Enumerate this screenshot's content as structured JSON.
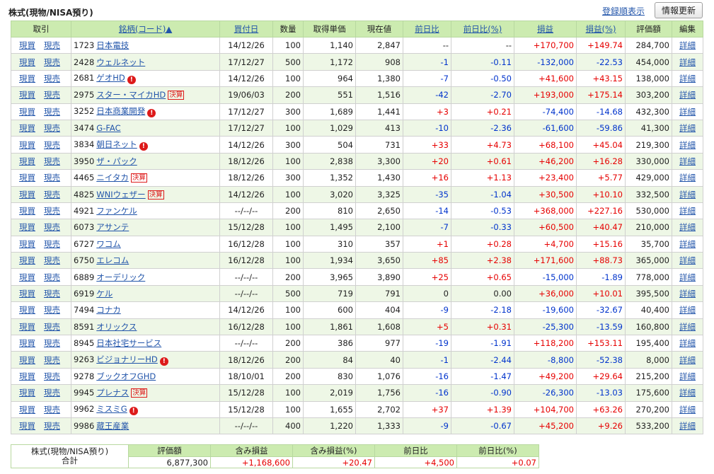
{
  "header": {
    "title": "株式(現物/NISA預り)",
    "sort_link": "登録順表示",
    "refresh_button": "情報更新"
  },
  "columns": {
    "trade": "取引",
    "name": "銘柄(コード)▲",
    "buy_date": "買付日",
    "qty": "数量",
    "cost": "取得単価",
    "price": "現在値",
    "change": "前日比",
    "change_pct": "前日比(%)",
    "pl": "損益",
    "pl_pct": "損益(%)",
    "value": "評価額",
    "edit": "編集"
  },
  "labels": {
    "buy": "現買",
    "sell": "現売",
    "detail": "詳細",
    "kessan": "決算",
    "alert_mark": "!"
  },
  "rows": [
    {
      "code": "1723",
      "name": "日本電技",
      "mark": "",
      "date": "14/12/26",
      "qty": "100",
      "cost": "1,140",
      "price": "2,847",
      "chg": "--",
      "chgpct": "--",
      "pl": "+170,700",
      "plpct": "+149.74",
      "value": "284,700"
    },
    {
      "code": "2428",
      "name": "ウェルネット",
      "mark": "",
      "date": "17/12/27",
      "qty": "500",
      "cost": "1,172",
      "price": "908",
      "chg": "-1",
      "chgpct": "-0.11",
      "pl": "-132,000",
      "plpct": "-22.53",
      "value": "454,000"
    },
    {
      "code": "2681",
      "name": "ゲオHD",
      "mark": "alert",
      "date": "14/12/26",
      "qty": "100",
      "cost": "964",
      "price": "1,380",
      "chg": "-7",
      "chgpct": "-0.50",
      "pl": "+41,600",
      "plpct": "+43.15",
      "value": "138,000"
    },
    {
      "code": "2975",
      "name": "スター・マイカHD",
      "mark": "kessan",
      "date": "19/06/03",
      "qty": "200",
      "cost": "551",
      "price": "1,516",
      "chg": "-42",
      "chgpct": "-2.70",
      "pl": "+193,000",
      "plpct": "+175.14",
      "value": "303,200"
    },
    {
      "code": "3252",
      "name": "日本商業開発",
      "mark": "alert",
      "date": "17/12/27",
      "qty": "300",
      "cost": "1,689",
      "price": "1,441",
      "chg": "+3",
      "chgpct": "+0.21",
      "pl": "-74,400",
      "plpct": "-14.68",
      "value": "432,300"
    },
    {
      "code": "3474",
      "name": "G-FAC",
      "mark": "",
      "date": "17/12/27",
      "qty": "100",
      "cost": "1,029",
      "price": "413",
      "chg": "-10",
      "chgpct": "-2.36",
      "pl": "-61,600",
      "plpct": "-59.86",
      "value": "41,300"
    },
    {
      "code": "3834",
      "name": "朝日ネット",
      "mark": "alert",
      "date": "14/12/26",
      "qty": "300",
      "cost": "504",
      "price": "731",
      "chg": "+33",
      "chgpct": "+4.73",
      "pl": "+68,100",
      "plpct": "+45.04",
      "value": "219,300"
    },
    {
      "code": "3950",
      "name": "ザ・パック",
      "mark": "",
      "date": "18/12/26",
      "qty": "100",
      "cost": "2,838",
      "price": "3,300",
      "chg": "+20",
      "chgpct": "+0.61",
      "pl": "+46,200",
      "plpct": "+16.28",
      "value": "330,000"
    },
    {
      "code": "4465",
      "name": "ニイタカ",
      "mark": "kessan",
      "date": "18/12/26",
      "qty": "300",
      "cost": "1,352",
      "price": "1,430",
      "chg": "+16",
      "chgpct": "+1.13",
      "pl": "+23,400",
      "plpct": "+5.77",
      "value": "429,000"
    },
    {
      "code": "4825",
      "name": "WNIウェザー",
      "mark": "kessan",
      "date": "14/12/26",
      "qty": "100",
      "cost": "3,020",
      "price": "3,325",
      "chg": "-35",
      "chgpct": "-1.04",
      "pl": "+30,500",
      "plpct": "+10.10",
      "value": "332,500"
    },
    {
      "code": "4921",
      "name": "ファンケル",
      "mark": "",
      "date": "--/--/--",
      "qty": "200",
      "cost": "810",
      "price": "2,650",
      "chg": "-14",
      "chgpct": "-0.53",
      "pl": "+368,000",
      "plpct": "+227.16",
      "value": "530,000"
    },
    {
      "code": "6073",
      "name": "アサンテ",
      "mark": "",
      "date": "15/12/28",
      "qty": "100",
      "cost": "1,495",
      "price": "2,100",
      "chg": "-7",
      "chgpct": "-0.33",
      "pl": "+60,500",
      "plpct": "+40.47",
      "value": "210,000"
    },
    {
      "code": "6727",
      "name": "ワコム",
      "mark": "",
      "date": "16/12/28",
      "qty": "100",
      "cost": "310",
      "price": "357",
      "chg": "+1",
      "chgpct": "+0.28",
      "pl": "+4,700",
      "plpct": "+15.16",
      "value": "35,700"
    },
    {
      "code": "6750",
      "name": "エレコム",
      "mark": "",
      "date": "16/12/28",
      "qty": "100",
      "cost": "1,934",
      "price": "3,650",
      "chg": "+85",
      "chgpct": "+2.38",
      "pl": "+171,600",
      "plpct": "+88.73",
      "value": "365,000"
    },
    {
      "code": "6889",
      "name": "オーデリック",
      "mark": "",
      "date": "--/--/--",
      "qty": "200",
      "cost": "3,965",
      "price": "3,890",
      "chg": "+25",
      "chgpct": "+0.65",
      "pl": "-15,000",
      "plpct": "-1.89",
      "value": "778,000"
    },
    {
      "code": "6919",
      "name": "ケル",
      "mark": "",
      "date": "--/--/--",
      "qty": "500",
      "cost": "719",
      "price": "791",
      "chg": "0",
      "chgpct": "0.00",
      "pl": "+36,000",
      "plpct": "+10.01",
      "value": "395,500"
    },
    {
      "code": "7494",
      "name": "コナカ",
      "mark": "",
      "date": "14/12/26",
      "qty": "100",
      "cost": "600",
      "price": "404",
      "chg": "-9",
      "chgpct": "-2.18",
      "pl": "-19,600",
      "plpct": "-32.67",
      "value": "40,400"
    },
    {
      "code": "8591",
      "name": "オリックス",
      "mark": "",
      "date": "16/12/28",
      "qty": "100",
      "cost": "1,861",
      "price": "1,608",
      "chg": "+5",
      "chgpct": "+0.31",
      "pl": "-25,300",
      "plpct": "-13.59",
      "value": "160,800"
    },
    {
      "code": "8945",
      "name": "日本社宅サービス",
      "mark": "",
      "date": "--/--/--",
      "qty": "200",
      "cost": "386",
      "price": "977",
      "chg": "-19",
      "chgpct": "-1.91",
      "pl": "+118,200",
      "plpct": "+153.11",
      "value": "195,400"
    },
    {
      "code": "9263",
      "name": "ビジョナリーHD",
      "mark": "alert",
      "date": "18/12/26",
      "qty": "200",
      "cost": "84",
      "price": "40",
      "chg": "-1",
      "chgpct": "-2.44",
      "pl": "-8,800",
      "plpct": "-52.38",
      "value": "8,000"
    },
    {
      "code": "9278",
      "name": "ブックオフGHD",
      "mark": "",
      "date": "18/10/01",
      "qty": "200",
      "cost": "830",
      "price": "1,076",
      "chg": "-16",
      "chgpct": "-1.47",
      "pl": "+49,200",
      "plpct": "+29.64",
      "value": "215,200"
    },
    {
      "code": "9945",
      "name": "プレナス",
      "mark": "kessan",
      "date": "15/12/28",
      "qty": "100",
      "cost": "2,019",
      "price": "1,756",
      "chg": "-16",
      "chgpct": "-0.90",
      "pl": "-26,300",
      "plpct": "-13.03",
      "value": "175,600"
    },
    {
      "code": "9962",
      "name": "ミスミG",
      "mark": "alert",
      "date": "15/12/28",
      "qty": "100",
      "cost": "1,655",
      "price": "2,702",
      "chg": "+37",
      "chgpct": "+1.39",
      "pl": "+104,700",
      "plpct": "+63.26",
      "value": "270,200"
    },
    {
      "code": "9986",
      "name": "蔵王産業",
      "mark": "",
      "date": "--/--/--",
      "qty": "400",
      "cost": "1,220",
      "price": "1,333",
      "chg": "-9",
      "chgpct": "-0.67",
      "pl": "+45,200",
      "plpct": "+9.26",
      "value": "533,200"
    }
  ],
  "summary": {
    "label_line1": "株式(現物/NISA預り)",
    "label_line2": "合計",
    "headers": [
      "評価額",
      "含み損益",
      "含み損益(%)",
      "前日比",
      "前日比(%)"
    ],
    "values": [
      "6,877,300",
      "+1,168,600",
      "+20.47",
      "+4,500",
      "+0.07"
    ]
  },
  "colors": {
    "header_bg": "#ccebb0",
    "row_alt_bg": "#eef7e6",
    "positive": "#e60000",
    "negative": "#0033cc",
    "link": "#2255aa"
  }
}
